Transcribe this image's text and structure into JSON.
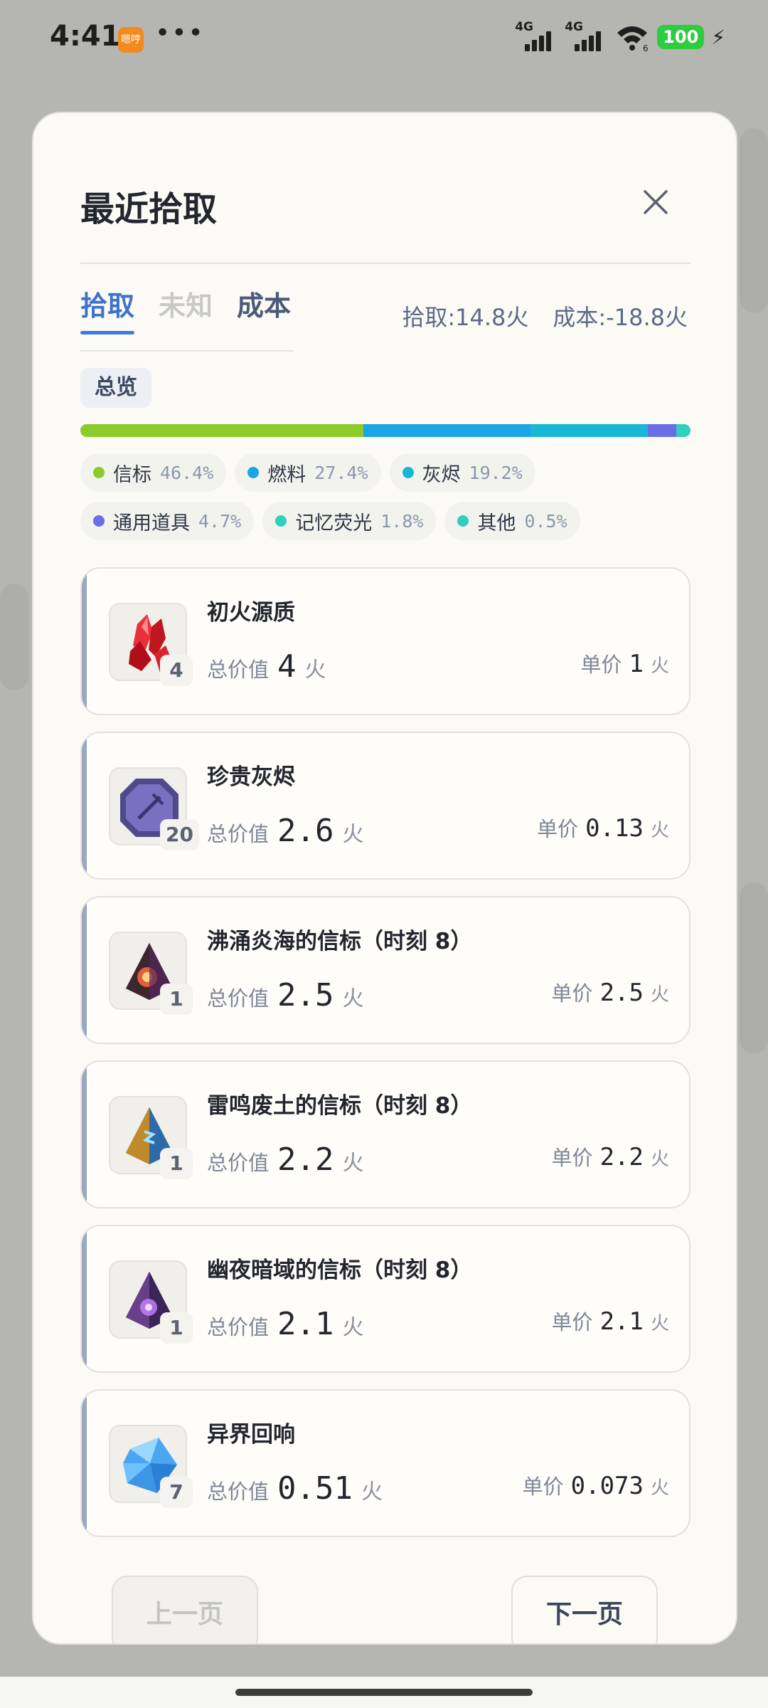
{
  "status_bar": {
    "time": "4:41",
    "app_badge": "嗯哼",
    "more": "•••",
    "signal1": "4G",
    "signal2": "4G",
    "wifi_sub": "6",
    "battery": "100"
  },
  "modal": {
    "title": "最近拾取",
    "tabs": [
      {
        "label": "拾取",
        "state": "active"
      },
      {
        "label": "未知",
        "state": "disabled"
      },
      {
        "label": "成本",
        "state": "normal"
      }
    ],
    "pickup_total": "拾取:14.8火",
    "cost_total": "成本:-18.8火",
    "overview_label": "总览",
    "breakdown": [
      {
        "name": "信标",
        "pct_text": "46.4%",
        "pct": 46.4,
        "color": "#8ccb2a"
      },
      {
        "name": "燃料",
        "pct_text": "27.4%",
        "pct": 27.4,
        "color": "#1aa5e6"
      },
      {
        "name": "灰烬",
        "pct_text": "19.2%",
        "pct": 19.2,
        "color": "#18b7d5"
      },
      {
        "name": "通用道具",
        "pct_text": "4.7%",
        "pct": 4.7,
        "color": "#6b6ce8"
      },
      {
        "name": "记忆荧光",
        "pct_text": "1.8%",
        "pct": 1.8,
        "color": "#2fd1bd"
      },
      {
        "name": "其他",
        "pct_text": "0.5%",
        "pct": 0.5,
        "color": "#2fcfbf"
      }
    ],
    "items": [
      {
        "name": "初火源质",
        "qty": "4",
        "total_label": "总价值",
        "total": "4",
        "total_unit": "火",
        "unit_label": "单价",
        "unit_price": "1",
        "unit_unit": "火",
        "icon": "red-crystal-icon"
      },
      {
        "name": "珍贵灰烬",
        "qty": "20",
        "total_label": "总价值",
        "total": "2.6",
        "total_unit": "火",
        "unit_label": "单价",
        "unit_price": "0.13",
        "unit_unit": "火",
        "icon": "purple-ash-tile-icon"
      },
      {
        "name": "沸涌炎海的信标（时刻 8）",
        "qty": "1",
        "total_label": "总价值",
        "total": "2.5",
        "total_unit": "火",
        "unit_label": "单价",
        "unit_price": "2.5",
        "unit_unit": "火",
        "icon": "fire-beacon-pyramid-icon"
      },
      {
        "name": "雷鸣废土的信标（时刻 8）",
        "qty": "1",
        "total_label": "总价值",
        "total": "2.2",
        "total_unit": "火",
        "unit_label": "单价",
        "unit_price": "2.2",
        "unit_unit": "火",
        "icon": "thunder-beacon-pyramid-icon"
      },
      {
        "name": "幽夜暗域的信标（时刻 8）",
        "qty": "1",
        "total_label": "总价值",
        "total": "2.1",
        "total_unit": "火",
        "unit_label": "单价",
        "unit_price": "2.1",
        "unit_unit": "火",
        "icon": "night-beacon-pyramid-icon"
      },
      {
        "name": "异界回响",
        "qty": "7",
        "total_label": "总价值",
        "total": "0.51",
        "total_unit": "火",
        "unit_label": "单价",
        "unit_price": "0.073",
        "unit_unit": "火",
        "icon": "blue-crystal-icon"
      }
    ],
    "prev_label": "上一页",
    "next_label": "下一页"
  }
}
